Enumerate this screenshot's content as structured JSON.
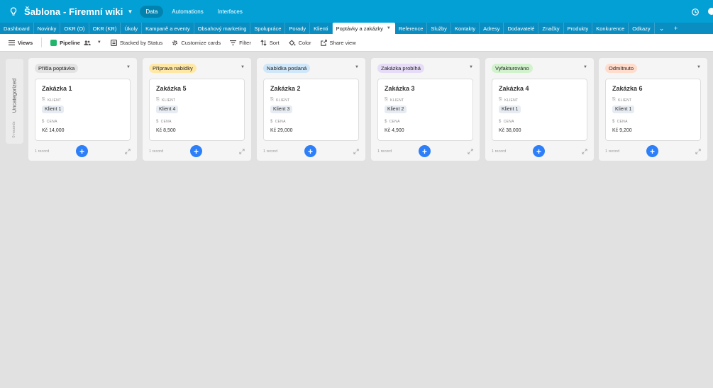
{
  "app": {
    "base_title": "Šablona - Firemní wiki",
    "nav": [
      {
        "label": "Data",
        "active": true
      },
      {
        "label": "Automations",
        "active": false
      },
      {
        "label": "Interfaces",
        "active": false
      }
    ]
  },
  "tables": [
    "Dashboard",
    "Novinky",
    "OKR (O)",
    "OKR (KR)",
    "Úkoly",
    "Kampaně a eventy",
    "Obsahový marketing",
    "Spolupráce",
    "Porady",
    "Klienti",
    "Poptávky a zakázky",
    "Reference",
    "Služby",
    "Kontakty",
    "Adresy",
    "Dodavatelé",
    "Značky",
    "Produkty",
    "Konkurence",
    "Odkazy"
  ],
  "active_table": "Poptávky a zakázky",
  "toolbar": {
    "views": "Views",
    "view_name": "Pipeline",
    "stacked": "Stacked by Status",
    "customize": "Customize cards",
    "filter": "Filter",
    "sort": "Sort",
    "color": "Color",
    "share": "Share view"
  },
  "uncategorized": {
    "label": "Uncategorized",
    "count": "0 records"
  },
  "field_labels": {
    "client": "KLIENT",
    "price": "CENA"
  },
  "colors": {
    "appbar": "#03a0d6",
    "tabsbar": "#0a8dc0",
    "add_button": "#2d7ff9"
  },
  "columns": [
    {
      "status": "Přišla poptávka",
      "pill_color": "#e3e3e3",
      "card": {
        "title": "Zakázka 1",
        "client": "Klient 1",
        "price": "Kč 14,000"
      },
      "count": "1 record"
    },
    {
      "status": "Příprava nabídky",
      "pill_color": "#ffe8a6",
      "card": {
        "title": "Zakázka 5",
        "client": "Klient 4",
        "price": "Kč 8,500"
      },
      "count": "1 record"
    },
    {
      "status": "Nabídka poslaná",
      "pill_color": "#cfe7f8",
      "card": {
        "title": "Zakázka 2",
        "client": "Klient 3",
        "price": "Kč 29,000"
      },
      "count": "1 record"
    },
    {
      "status": "Zakázka probíhá",
      "pill_color": "#e6dcf7",
      "card": {
        "title": "Zakázka 3",
        "client": "Klient 2",
        "price": "Kč 4,900"
      },
      "count": "1 record"
    },
    {
      "status": "Vyfakturováno",
      "pill_color": "#d1f2cd",
      "card": {
        "title": "Zakázka 4",
        "client": "Klient 1",
        "price": "Kč 38,000"
      },
      "count": "1 record"
    },
    {
      "status": "Odmítnuto",
      "pill_color": "#ffdccc",
      "card": {
        "title": "Zakázka 6",
        "client": "Klient 1",
        "price": "Kč 9,200"
      },
      "count": "1 record"
    }
  ]
}
